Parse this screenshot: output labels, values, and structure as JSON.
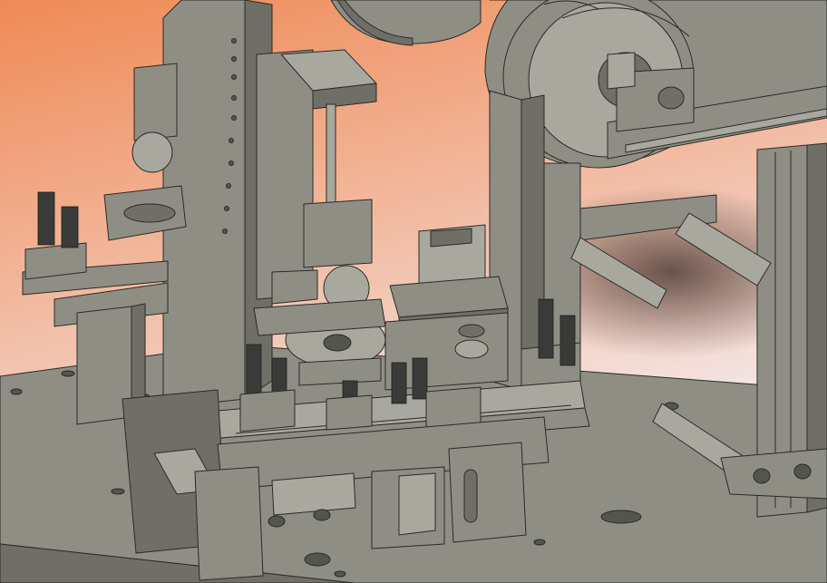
{
  "viewport": {
    "background_top": "#ef8a55",
    "background_mid": "#f2b79c",
    "background_bottom": "#f4f1f6"
  },
  "model": {
    "part_color": "#8e8e85",
    "part_light": "#a8a89f",
    "part_dark": "#6f6f67",
    "edge_color": "#2b2b27",
    "brush_color": "#3a3a38"
  }
}
